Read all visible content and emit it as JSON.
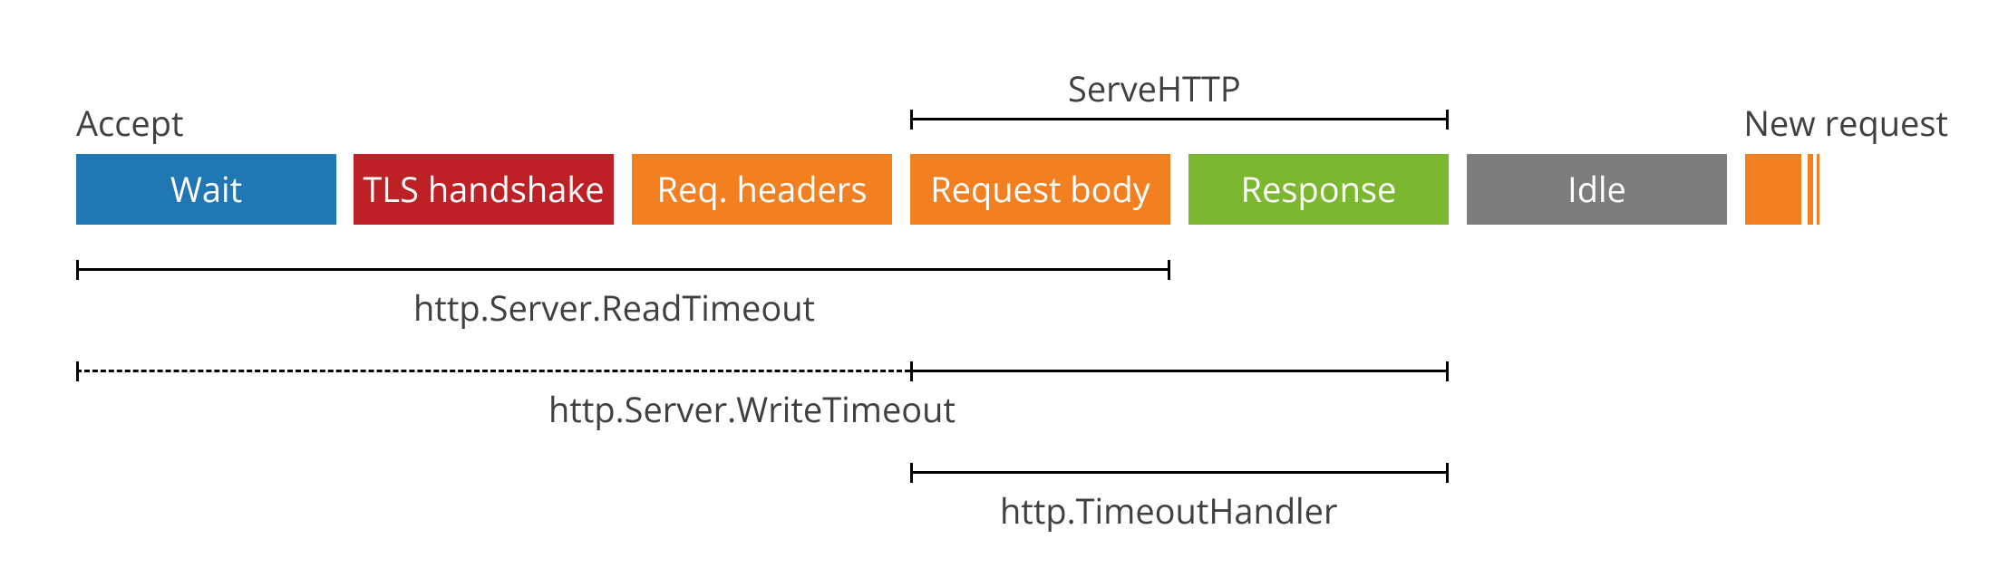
{
  "labels": {
    "accept": "Accept",
    "new_request": "New request"
  },
  "phases": {
    "wait": "Wait",
    "tls": "TLS handshake",
    "req_headers": "Req. headers",
    "req_body": "Request body",
    "response": "Response",
    "idle": "Idle"
  },
  "spans": {
    "serve_http": "ServeHTTP",
    "read_timeout": "http.Server.ReadTimeout",
    "write_timeout": "http.Server.WriteTimeout",
    "timeout_handler": "http.TimeoutHandler"
  },
  "colors": {
    "blue": "#2077b3",
    "red": "#bd2025",
    "orange": "#f38020",
    "green": "#7cb82f",
    "gray": "#7d7d7d",
    "text": "#404040"
  },
  "chart_data": {
    "type": "timeline",
    "title": "HTTP server request lifecycle timeouts",
    "phases": [
      {
        "name": "Wait",
        "start": 0,
        "end": 287,
        "color": "blue"
      },
      {
        "name": "TLS handshake",
        "start": 306,
        "end": 593,
        "color": "red"
      },
      {
        "name": "Req. headers",
        "start": 613,
        "end": 900,
        "color": "orange"
      },
      {
        "name": "Request body",
        "start": 920,
        "end": 1207,
        "color": "orange"
      },
      {
        "name": "Response",
        "start": 1227,
        "end": 1514,
        "color": "green"
      },
      {
        "name": "Idle",
        "start": 1534,
        "end": 1821,
        "color": "gray"
      },
      {
        "name": "New (start)",
        "start": 1841,
        "end": 1923,
        "color": "orange"
      }
    ],
    "spans": [
      {
        "name": "ServeHTTP",
        "from": 920,
        "to": 1514,
        "label_y": "above"
      },
      {
        "name": "http.Server.ReadTimeout",
        "from": 0,
        "to": 1207,
        "label_y": "below"
      },
      {
        "name": "http.Server.WriteTimeout",
        "from": 0,
        "to": 1514,
        "label_y": "below",
        "dashed_from": 0,
        "dashed_to": 920
      },
      {
        "name": "http.TimeoutHandler",
        "from": 920,
        "to": 1514,
        "label_y": "below"
      }
    ],
    "markers": [
      {
        "name": "Accept",
        "at": 0
      },
      {
        "name": "New request",
        "at": 1841
      }
    ]
  }
}
